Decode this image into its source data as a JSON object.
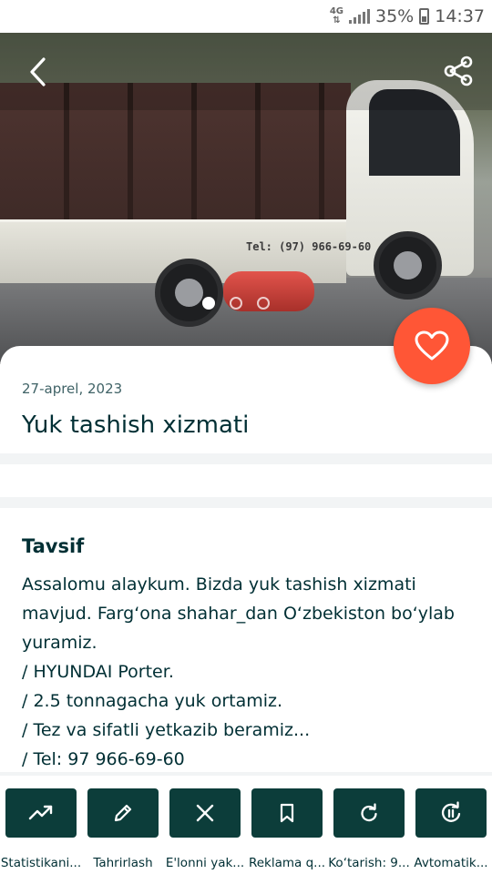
{
  "status_bar": {
    "network": "4G",
    "battery": "35%",
    "time": "14:37"
  },
  "gallery": {
    "image_text": "Tel: (97) 966-69-60",
    "image_count": 3,
    "active_index": 0
  },
  "ad": {
    "date": "27-aprel, 2023",
    "title": "Yuk tashish xizmati"
  },
  "description": {
    "heading": "Tavsif",
    "lines": [
      "Assalomu alaykum. Bizda yuk tashish xizmati",
      "mavjud. Farg‘ona shahar_dan O‘zbekiston bo‘ylab",
      "yuramiz.",
      "/ HYUNDAI Porter.",
      "/ 2.5 tonnagacha yuk ortamiz.",
      "/ Tez va sifatli yetkazib beramiz...",
      "/ Tel: 97 966-69-60"
    ]
  },
  "actions": [
    {
      "label": "Statistikani...",
      "icon": "trending-up-icon"
    },
    {
      "label": "Tahrirlash",
      "icon": "pencil-icon"
    },
    {
      "label": "E'lonni yak...",
      "icon": "close-icon"
    },
    {
      "label": "Reklama q...",
      "icon": "bookmark-icon"
    },
    {
      "label": "Ko‘tarish: 9...",
      "icon": "refresh-icon"
    },
    {
      "label": "Avtomatik...",
      "icon": "auto-renew-icon"
    }
  ],
  "colors": {
    "primary_dark": "#0c3d3a",
    "favorite": "#ff5636",
    "text": "#002f34"
  }
}
